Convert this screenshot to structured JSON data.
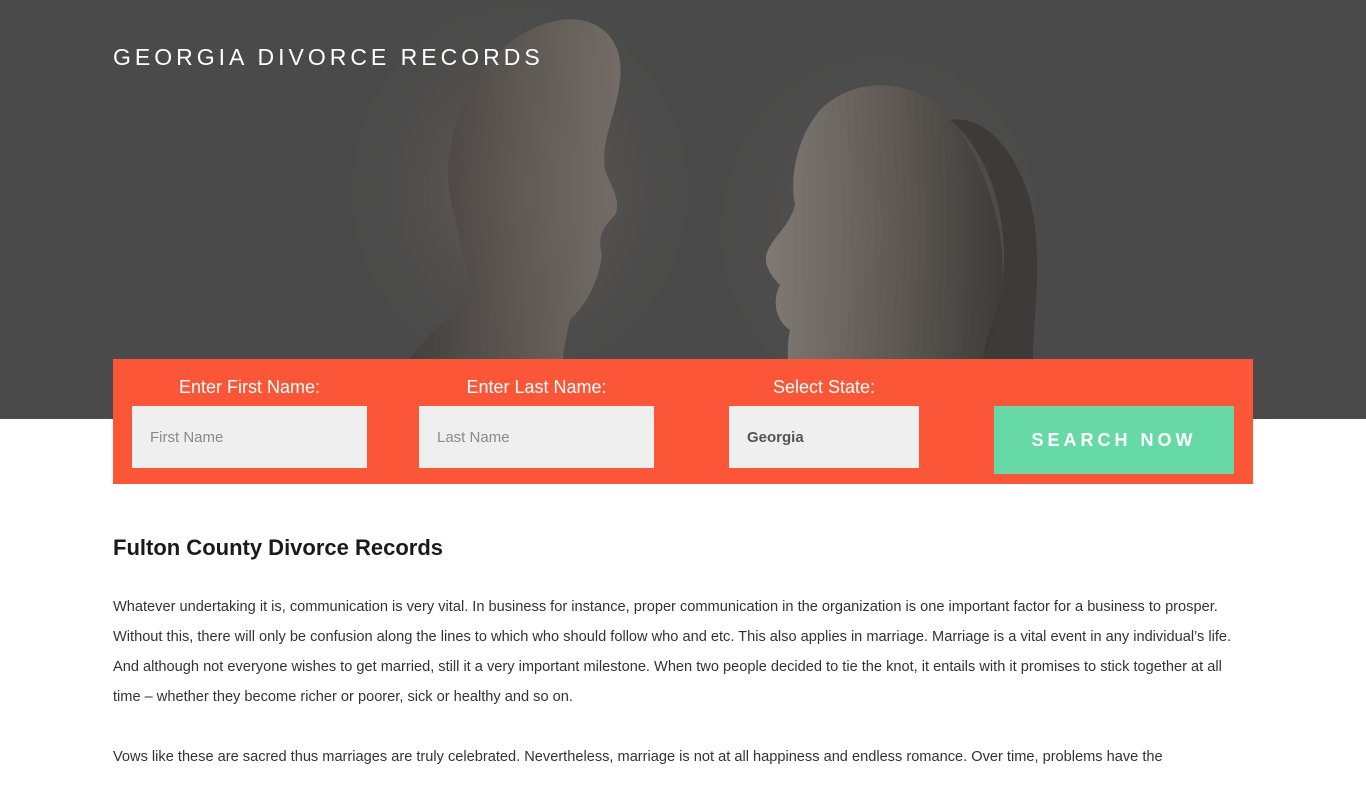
{
  "header": {
    "site_title": "GEORGIA DIVORCE RECORDS"
  },
  "search": {
    "first_name_label": "Enter First Name:",
    "first_name_placeholder": "First Name",
    "last_name_label": "Enter Last Name:",
    "last_name_placeholder": "Last Name",
    "state_label": "Select State:",
    "state_value": "Georgia",
    "button_label": "SEARCH NOW"
  },
  "article": {
    "heading": "Fulton County Divorce Records",
    "paragraphs": [
      "Whatever undertaking it is, communication is very vital. In business for instance, proper communication in the organization is one important factor for a business to prosper. Without this, there will only be confusion along the lines to which who should follow who and etc. This also applies in marriage. Marriage is a vital event in any individual’s life. And although not everyone wishes to get married, still it a very important milestone. When two people decided to tie the knot, it entails with it promises to stick together at all time – whether they become richer or poorer, sick or healthy and so on.",
      "Vows like these are sacred thus marriages are truly celebrated. Nevertheless, marriage is not at all happiness and endless romance. Over time, problems have the"
    ]
  },
  "colors": {
    "hero_bg": "#4a4a4a",
    "panel_accent": "#fa5637",
    "button_green": "#66d9a7",
    "input_bg": "#efefef"
  }
}
